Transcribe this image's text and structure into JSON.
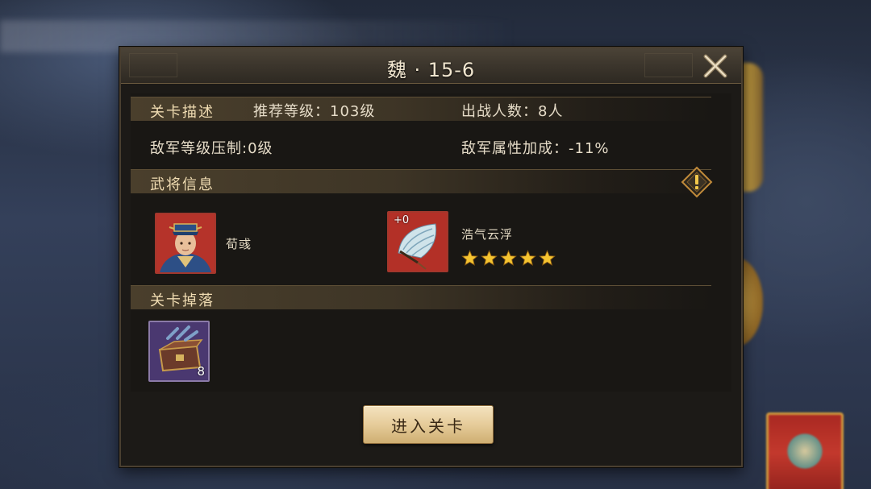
{
  "dialog": {
    "title": "魏 · 15-6"
  },
  "stage_info": {
    "section_title": "关卡描述",
    "recommended_level": "推荐等级：103级",
    "team_size": "出战人数：8人",
    "enemy_level_suppression": "敌军等级压制:0级",
    "enemy_attribute_bonus": "敌军属性加成：-11%"
  },
  "general_info": {
    "section_title": "武将信息",
    "hero": {
      "name": "荀彧",
      "icon": "hero-portrait"
    },
    "treasure": {
      "name": "浩气云浮",
      "enhance": "+0",
      "icon": "feather-fan",
      "stars": 5
    }
  },
  "drops": {
    "section_title": "关卡掉落",
    "items": [
      {
        "icon": "treasure-chest",
        "count": "8"
      }
    ]
  },
  "actions": {
    "enter_label": "进入关卡"
  },
  "colors": {
    "panel_bg": "#1c1a17",
    "section_bar": "#4a3f2c",
    "title_text": "#f1e6cf",
    "button_gold": "#e6cc9a",
    "hero_frame_red": "#a3372c",
    "drop_frame_purple": "#54407a",
    "star_gold": "#f5c431"
  }
}
